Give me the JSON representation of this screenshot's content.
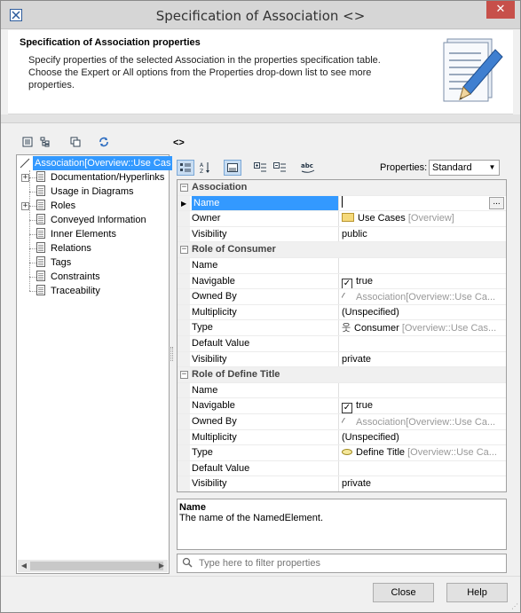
{
  "window": {
    "title": "Specification of Association <>",
    "close_glyph": "✕"
  },
  "header": {
    "title": "Specification of Association properties",
    "description": "Specify properties of the selected Association in the properties specification table. Choose the Expert or All options from the Properties drop-down list to see more properties."
  },
  "breadcrumb": "<>",
  "tree": {
    "items": [
      {
        "label": "Association[Overview::Use Cas",
        "selected": true,
        "icon": "association-icon"
      },
      {
        "label": "Documentation/Hyperlinks",
        "expandable": true,
        "icon": "page-icon"
      },
      {
        "label": "Usage in Diagrams",
        "icon": "page-icon"
      },
      {
        "label": "Roles",
        "expandable": true,
        "icon": "page-icon"
      },
      {
        "label": "Conveyed Information",
        "icon": "page-icon"
      },
      {
        "label": "Inner Elements",
        "icon": "page-icon"
      },
      {
        "label": "Relations",
        "icon": "page-icon"
      },
      {
        "label": "Tags",
        "icon": "page-icon"
      },
      {
        "label": "Constraints",
        "icon": "page-icon"
      },
      {
        "label": "Traceability",
        "icon": "page-icon"
      }
    ]
  },
  "properties": {
    "label": "Properties:",
    "mode": "Standard"
  },
  "grid": {
    "association_group": "Association",
    "name_label": "Name",
    "name_value": "",
    "owner_label": "Owner",
    "owner_value": "Use Cases",
    "owner_path": "[Overview]",
    "visibility_label": "Visibility",
    "visibility_value": "public",
    "consumer_group": "Role of Consumer",
    "c_name_label": "Name",
    "c_navigable_label": "Navigable",
    "c_navigable_value": "true",
    "c_owned_label": "Owned By",
    "c_owned_value": "Association[Overview::Use Ca...",
    "c_mult_label": "Multiplicity",
    "c_mult_value": "(Unspecified)",
    "c_type_label": "Type",
    "c_type_value": "Consumer",
    "c_type_path": "[Overview::Use Cas...",
    "c_default_label": "Default Value",
    "c_vis_label": "Visibility",
    "c_vis_value": "private",
    "define_group": "Role of Define Title",
    "d_name_label": "Name",
    "d_navigable_label": "Navigable",
    "d_navigable_value": "true",
    "d_owned_label": "Owned By",
    "d_owned_value": "Association[Overview::Use Ca...",
    "d_mult_label": "Multiplicity",
    "d_mult_value": "(Unspecified)",
    "d_type_label": "Type",
    "d_type_value": "Define Title",
    "d_type_path": "[Overview::Use Ca...",
    "d_default_label": "Default Value",
    "d_vis_label": "Visibility",
    "d_vis_value": "private",
    "ellipsis": "..."
  },
  "description": {
    "title": "Name",
    "text": "The name of the NamedElement."
  },
  "filter": {
    "placeholder": "Type here to filter properties"
  },
  "buttons": {
    "close": "Close",
    "help": "Help"
  },
  "colors": {
    "selection": "#3399ff",
    "titlebar": "#d6d6d6",
    "close_button": "#c7504a"
  }
}
